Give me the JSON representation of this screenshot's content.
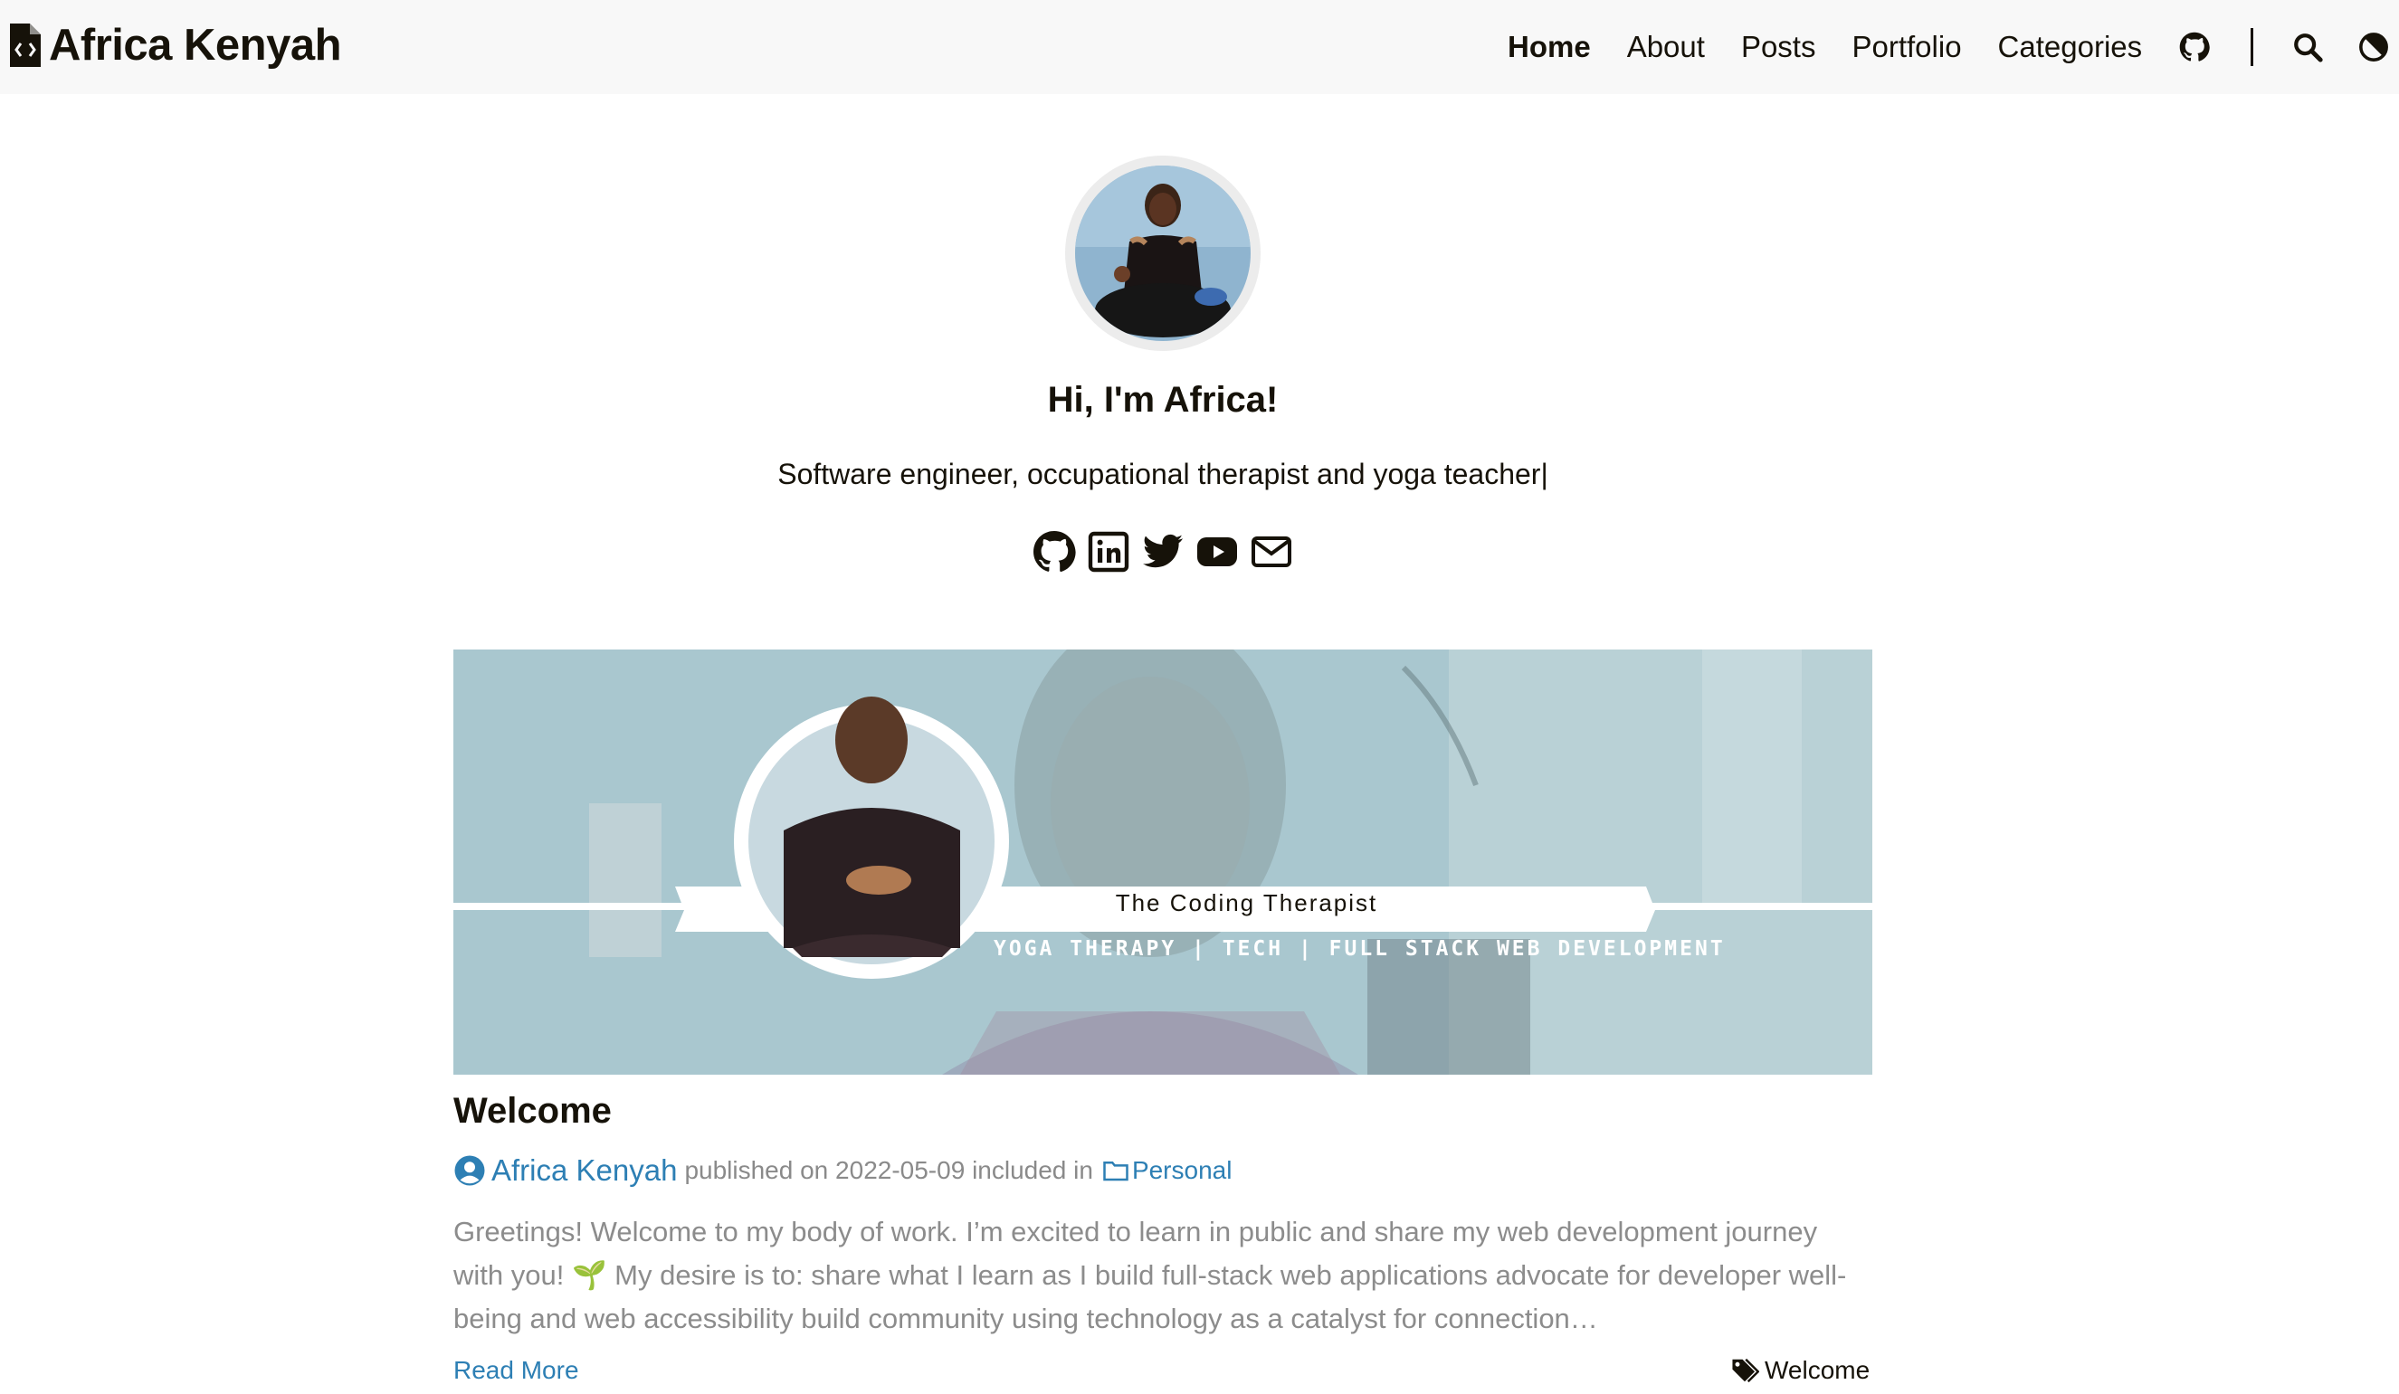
{
  "header": {
    "site_title": "Africa Kenyah",
    "nav": [
      {
        "label": "Home",
        "active": true
      },
      {
        "label": "About",
        "active": false
      },
      {
        "label": "Posts",
        "active": false
      },
      {
        "label": "Portfolio",
        "active": false
      },
      {
        "label": "Categories",
        "active": false
      }
    ],
    "icons": [
      "github-icon",
      "search-icon",
      "theme-toggle-icon"
    ]
  },
  "profile": {
    "greeting": "Hi, I'm Africa!",
    "subtitle": "Software engineer, occupational therapist and yoga teacher|",
    "socials": [
      "github-icon",
      "linkedin-icon",
      "twitter-icon",
      "youtube-icon",
      "email-icon"
    ]
  },
  "post": {
    "banner": {
      "title": "The Coding Therapist",
      "tags": "YOGA THERAPY | TECH | FULL STACK WEB DEVELOPMENT"
    },
    "title": "Welcome",
    "author": "Africa Kenyah",
    "published_prefix": "published on",
    "date": "2022-05-09",
    "included_in": "included in",
    "category": "Personal",
    "excerpt": "Greetings! Welcome to my body of work. I’m excited to learn in public and share my web development journey with you! 🌱 My desire is to: share what I learn as I build full-stack web applications advocate for developer well-being and web accessibility build community using technology as a catalyst for connection…",
    "read_more": "Read More",
    "tag": "Welcome"
  },
  "colors": {
    "text": "#161209",
    "link": "#2d7fb4",
    "muted": "#8c8c8c",
    "header_bg": "#f8f8f8",
    "banner_bg": "#a9c7cf"
  }
}
